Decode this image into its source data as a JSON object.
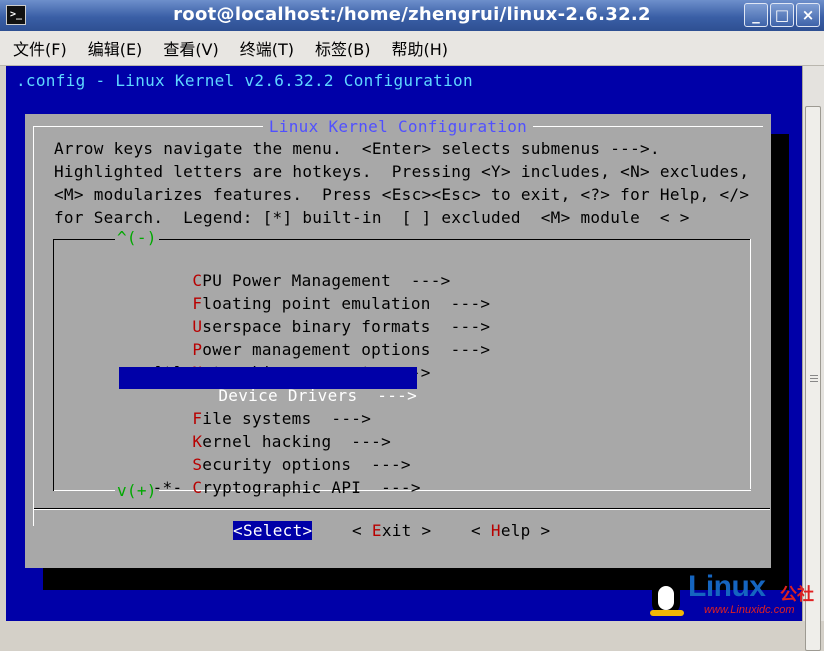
{
  "window": {
    "title": "root@localhost:/home/zhengrui/linux-2.6.32.2",
    "icon_label": ">_",
    "buttons": [
      "_",
      "□",
      "×"
    ]
  },
  "menubar": {
    "items": [
      "文件(F)",
      "编辑(E)",
      "查看(V)",
      "终端(T)",
      "标签(B)",
      "帮助(H)"
    ]
  },
  "terminal": {
    "config_title": ".config - Linux Kernel v2.6.32.2 Configuration",
    "colors": {
      "background": "#0000a8",
      "dialog": "#a8a8a8",
      "hotkey": "#b80000",
      "title": "#5050ff",
      "indicator": "#00a800"
    }
  },
  "dialog": {
    "title": "Linux Kernel Configuration",
    "help_lines": [
      "Arrow keys navigate the menu.  <Enter> selects submenus --->.",
      "Highlighted letters are hotkeys.  Pressing <Y> includes, <N> excludes,",
      "<M> modularizes features.  Press <Esc><Esc> to exit, <?> for Help, </>",
      "for Search.  Legend: [*] built-in  [ ] excluded  <M> module  < >"
    ],
    "scroll_up": "^(-)",
    "scroll_down": "v(+)",
    "items": [
      {
        "prefix": "    ",
        "hotkey": "C",
        "rest": "PU Power Management  --->",
        "selected": false
      },
      {
        "prefix": "    ",
        "hotkey": "F",
        "rest": "loating point emulation  --->",
        "selected": false
      },
      {
        "prefix": "    ",
        "hotkey": "U",
        "rest": "serspace binary formats  --->",
        "selected": false
      },
      {
        "prefix": "    ",
        "hotkey": "P",
        "rest": "ower management options  --->",
        "selected": false
      },
      {
        "prefix": "[*] ",
        "hotkey": "N",
        "rest": "etworking support  --->",
        "selected": false
      },
      {
        "prefix": "    ",
        "hotkey": "D",
        "rest": "evice Drivers  --->",
        "selected": true
      },
      {
        "prefix": "    ",
        "hotkey": "F",
        "rest": "ile systems  --->",
        "selected": false
      },
      {
        "prefix": "    ",
        "hotkey": "K",
        "rest": "ernel hacking  --->",
        "selected": false
      },
      {
        "prefix": "    ",
        "hotkey": "S",
        "rest": "ecurity options  --->",
        "selected": false
      },
      {
        "prefix": "-*- ",
        "hotkey": "C",
        "rest": "ryptographic API  --->",
        "selected": false
      }
    ],
    "buttons": [
      {
        "open": "<",
        "hotkey": "S",
        "rest": "elect",
        "close": ">",
        "active": true
      },
      {
        "open": "< ",
        "hotkey": "E",
        "rest": "xit",
        "close": " >",
        "active": false
      },
      {
        "open": "< ",
        "hotkey": "H",
        "rest": "elp",
        "close": " >",
        "active": false
      }
    ]
  },
  "watermark": {
    "brand": "Linux",
    "brand_cn": "公社",
    "url": "www.Linuxidc.com"
  }
}
